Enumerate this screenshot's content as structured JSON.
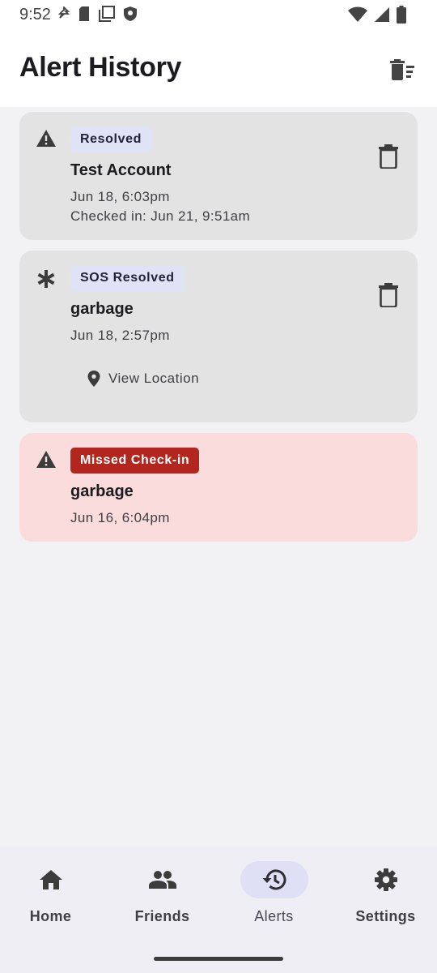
{
  "status_bar": {
    "time": "9:52"
  },
  "header": {
    "title": "Alert History",
    "clear_icon": "delete-sweep-icon"
  },
  "alerts": [
    {
      "icon": "warning-icon",
      "badge": "Resolved",
      "name": "Test Account",
      "time": "Jun 18, 6:03pm",
      "checked_in": "Checked in: Jun 21, 9:51am",
      "status_color": "#e0e2f6"
    },
    {
      "icon": "asterisk-icon",
      "badge": "SOS Resolved",
      "name": "garbage",
      "time": "Jun 18, 2:57pm",
      "action_label": "View Location",
      "status_color": "#e0e2f6"
    },
    {
      "icon": "warning-icon",
      "badge": "Missed Check-in",
      "name": "garbage",
      "time": "Jun 16, 6:04pm",
      "status_color": "#b3261e"
    }
  ],
  "nav": {
    "items": [
      {
        "label": "Home",
        "icon": "home-icon"
      },
      {
        "label": "Friends",
        "icon": "people-icon"
      },
      {
        "label": "Alerts",
        "icon": "history-icon",
        "active": true
      },
      {
        "label": "Settings",
        "icon": "gear-icon"
      }
    ]
  },
  "colors": {
    "card_neutral": "#e3e3e4",
    "card_danger": "#f9dcdb",
    "accent": "#dfe0f5",
    "danger": "#b3261e"
  }
}
